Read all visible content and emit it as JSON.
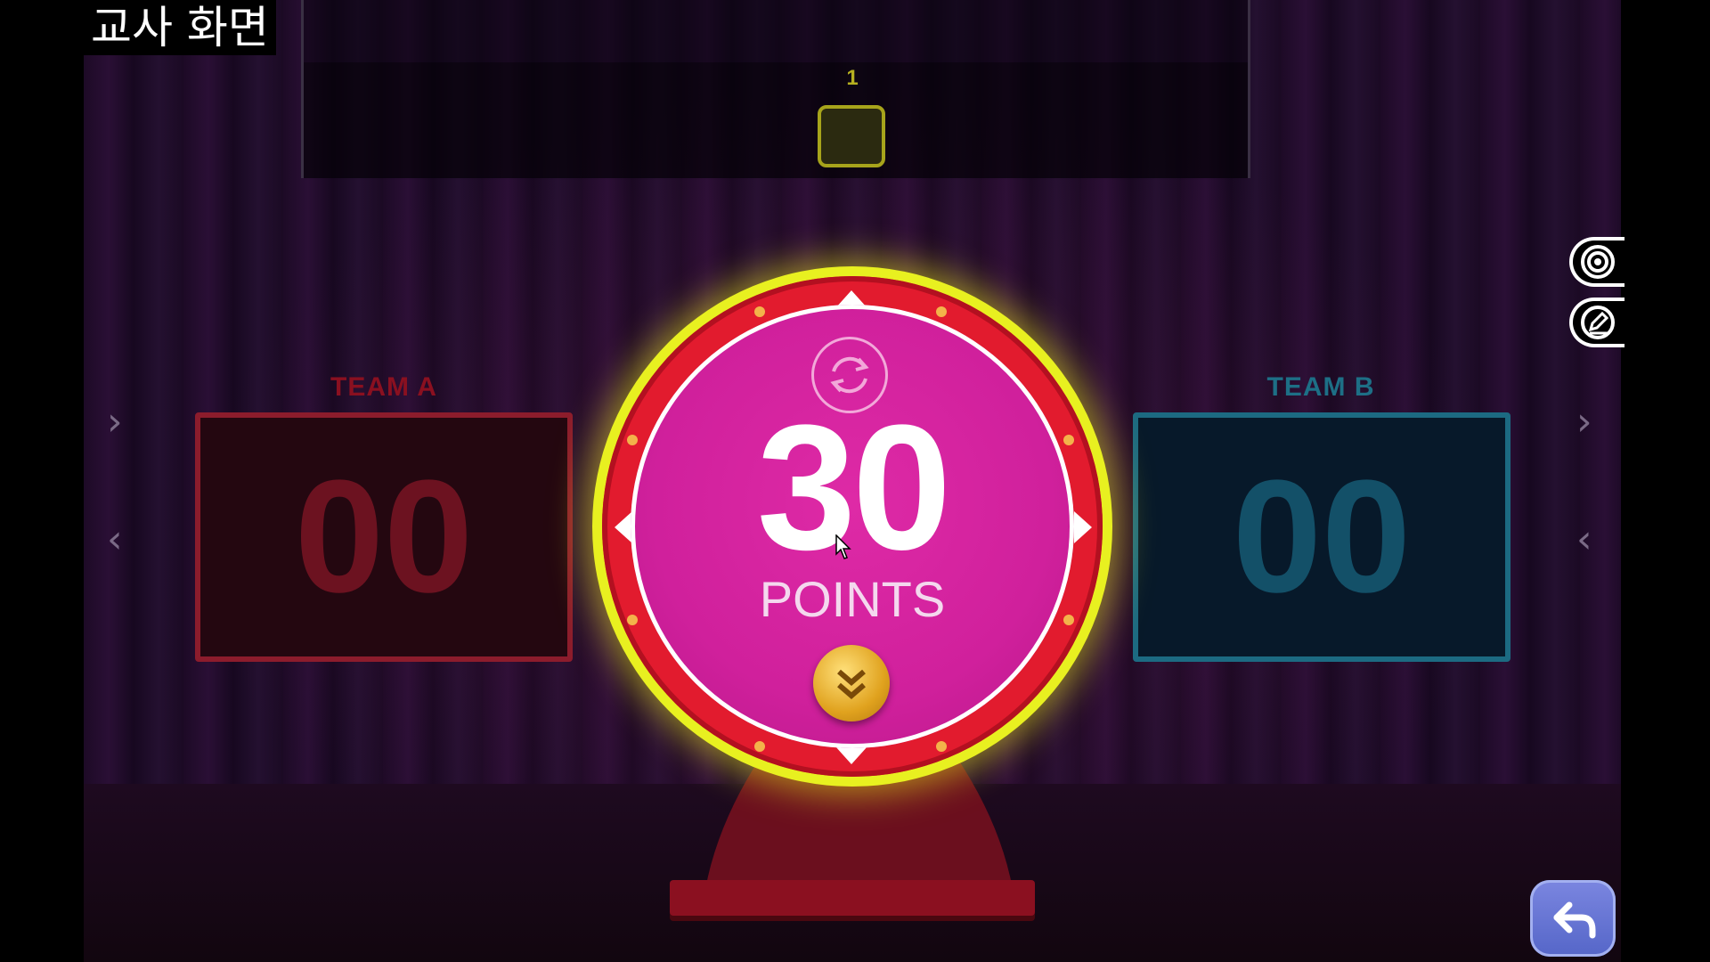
{
  "overlay": {
    "corner_label": "교사 화면"
  },
  "question_bar": {
    "current_number": "1"
  },
  "team_a": {
    "label": "TEAM A",
    "score": "00",
    "color": "#8c1c2c"
  },
  "team_b": {
    "label": "TEAM B",
    "score": "00",
    "color": "#1c6a82"
  },
  "wheel": {
    "points_value": "30",
    "points_label": "POINTS",
    "colors": {
      "ring": "#e21b2e",
      "glow": "#e8f020",
      "center": "#d0209c"
    }
  },
  "icons": {
    "refresh": "refresh-icon",
    "spin": "chevron-double-down-icon",
    "target": "target-icon",
    "pencil": "pencil-icon",
    "back": "undo-arrow-icon",
    "nav_up": "chevron-right-icon",
    "nav_down": "chevron-left-icon"
  }
}
